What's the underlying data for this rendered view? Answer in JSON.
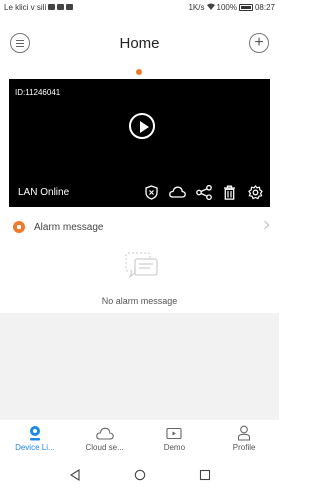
{
  "status_bar": {
    "left_text": "Le klici v sili",
    "right_text": "1K/s",
    "battery": "100%",
    "time": "08:27"
  },
  "header": {
    "title": "Home"
  },
  "camera": {
    "device_id": "ID:11246041",
    "connection_status": "LAN Online",
    "tools": [
      "alert-icon",
      "cloud-icon",
      "share-icon",
      "delete-icon",
      "settings-icon"
    ]
  },
  "alarm": {
    "label": "Alarm message",
    "empty_text": "No alarm message"
  },
  "tabs": [
    {
      "label": "Device Li...",
      "icon": "camera-icon",
      "active": true
    },
    {
      "label": "Cloud se...",
      "icon": "cloud-icon",
      "active": false
    },
    {
      "label": "Demo",
      "icon": "video-icon",
      "active": false
    },
    {
      "label": "Profile",
      "icon": "person-icon",
      "active": false
    }
  ],
  "colors": {
    "accent_orange": "#f07a2a",
    "active_blue": "#1e88e5",
    "video_bg": "#000000"
  }
}
